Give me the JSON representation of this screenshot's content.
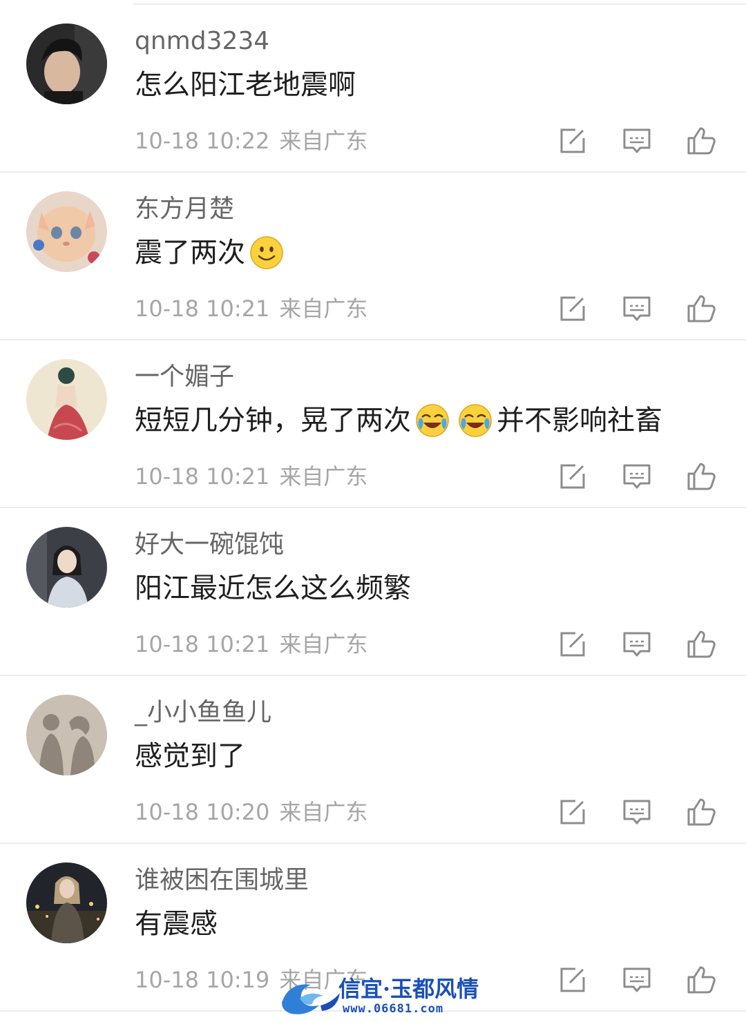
{
  "comments": [
    {
      "username": "qnmd3234",
      "content_parts": [
        "怎么阳江老地震啊"
      ],
      "time": "10-18 10:22",
      "location": "来自广东",
      "avatar_icon": "avatar-young-man-photo"
    },
    {
      "username": "东方月楚",
      "content_parts": [
        "震了两次"
      ],
      "emoji_after": [
        "smile-emoji"
      ],
      "time": "10-18 10:21",
      "location": "来自广东",
      "avatar_icon": "avatar-kitten-photo"
    },
    {
      "username": "一个媚子",
      "content_parts": [
        "短短几分钟，晃了两次",
        "并不影响社畜"
      ],
      "emoji_between": [
        "laugh-cry-emoji",
        "laugh-cry-emoji"
      ],
      "time": "10-18 10:21",
      "location": "来自广东",
      "avatar_icon": "avatar-illustration-woman"
    },
    {
      "username": "好大一碗馄饨",
      "content_parts": [
        "阳江最近怎么这么频繁"
      ],
      "time": "10-18 10:21",
      "location": "来自广东",
      "avatar_icon": "avatar-girl-photo"
    },
    {
      "username": "_小小鱼鱼儿",
      "content_parts": [
        "感觉到了"
      ],
      "time": "10-18 10:20",
      "location": "来自广东",
      "avatar_icon": "avatar-silhouette-couple"
    },
    {
      "username": "谁被困在围城里",
      "content_parts": [
        "有震感"
      ],
      "time": "10-18 10:19",
      "location": "来自广东",
      "avatar_icon": "avatar-night-city-photo"
    }
  ],
  "action_icons": [
    "edit-icon",
    "reply-comment-icon",
    "thumbs-up-icon"
  ],
  "watermark": {
    "title": "信宜·玉都风情",
    "url": "www.06681.com"
  },
  "colors": {
    "username": "#666666",
    "content": "#1f1f1f",
    "meta": "#a6a6a6",
    "divider": "#ececec",
    "icon": "#8c8c8c",
    "watermark": "#1a4fb8"
  }
}
